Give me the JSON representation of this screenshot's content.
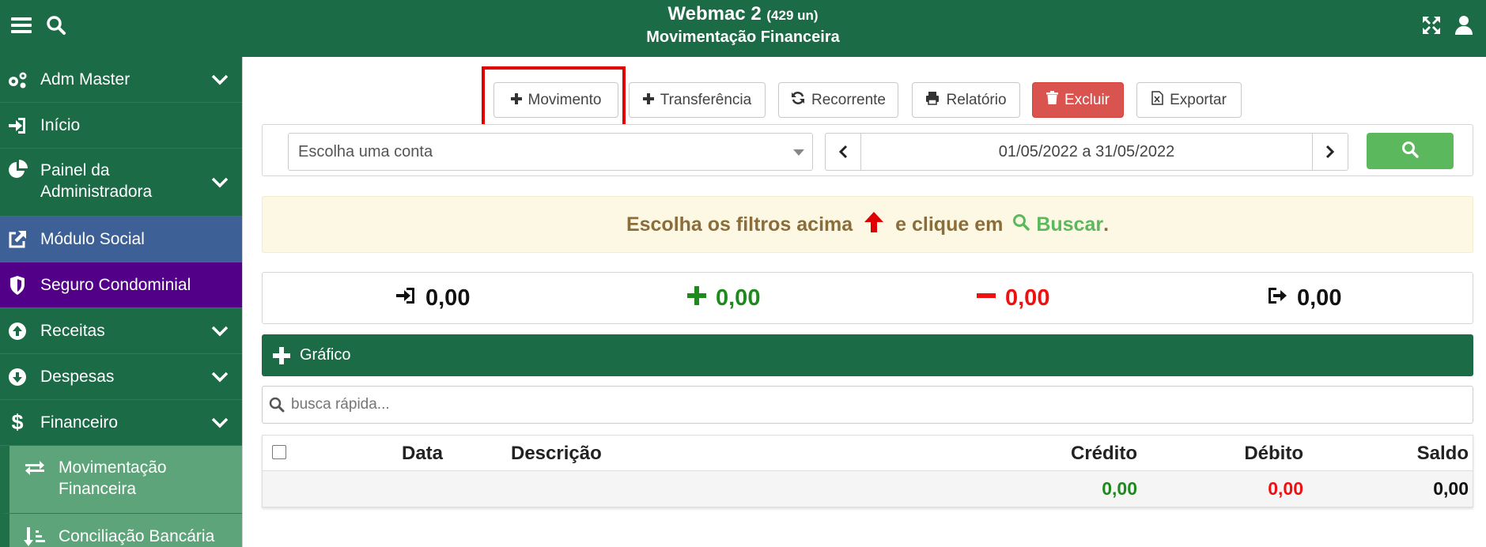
{
  "header": {
    "title": "Webmac 2",
    "count": "(429 un)",
    "subtitle": "Movimentação Financeira",
    "menu_icon": "bars-icon",
    "search_icon": "search-icon",
    "expand_icon": "expand-icon",
    "user_icon": "user-icon",
    "bg_color": "#1b6b46"
  },
  "sidebar": {
    "items": [
      {
        "label": "Adm Master",
        "icon": "gears-icon",
        "has_chevron": true
      },
      {
        "label": "Início",
        "icon": "sign-in-icon",
        "has_chevron": false
      },
      {
        "label": "Painel da Administradora",
        "icon": "pie-chart-icon",
        "has_chevron": true
      },
      {
        "label": "Módulo Social",
        "icon": "external-link-icon",
        "has_chevron": false,
        "bg": "#3d6196"
      },
      {
        "label": "Seguro Condominial",
        "icon": "shield-icon",
        "has_chevron": false,
        "bg": "#510087"
      },
      {
        "label": "Receitas",
        "icon": "arrow-circle-up-icon",
        "has_chevron": true
      },
      {
        "label": "Despesas",
        "icon": "arrow-circle-down-icon",
        "has_chevron": true
      },
      {
        "label": "Financeiro",
        "icon": "dollar-icon",
        "has_chevron": true
      },
      {
        "label": "Movimentação Financeira",
        "icon": "exchange-icon",
        "sub": true
      },
      {
        "label": "Conciliação Bancária",
        "icon": "sort-amount-icon",
        "sub": true
      }
    ]
  },
  "toolbar": {
    "movimento": "Movimento",
    "transferencia": "Transferência",
    "recorrente": "Recorrente",
    "relatorio": "Relatório",
    "excluir": "Excluir",
    "exportar": "Exportar"
  },
  "filters": {
    "account_placeholder": "Escolha uma conta",
    "date_range": "01/05/2022 a 31/05/2022"
  },
  "alert": {
    "text_before": "Escolha os filtros acima",
    "text_middle": "e clique em",
    "link": "Buscar",
    "text_after": "."
  },
  "summary": {
    "saldo_inicial": "0,00",
    "creditos": "0,00",
    "debitos": "0,00",
    "saldo_final": "0,00",
    "credit_color": "#1e8a1e",
    "debit_color": "#ee1111"
  },
  "grafico": {
    "label": "Gráfico"
  },
  "quick_search": {
    "placeholder": "busca rápida..."
  },
  "table": {
    "columns": [
      "Data",
      "Descrição",
      "Crédito",
      "Débito",
      "Saldo"
    ],
    "totals": {
      "credito": "0,00",
      "debito": "0,00",
      "saldo": "0,00"
    }
  }
}
